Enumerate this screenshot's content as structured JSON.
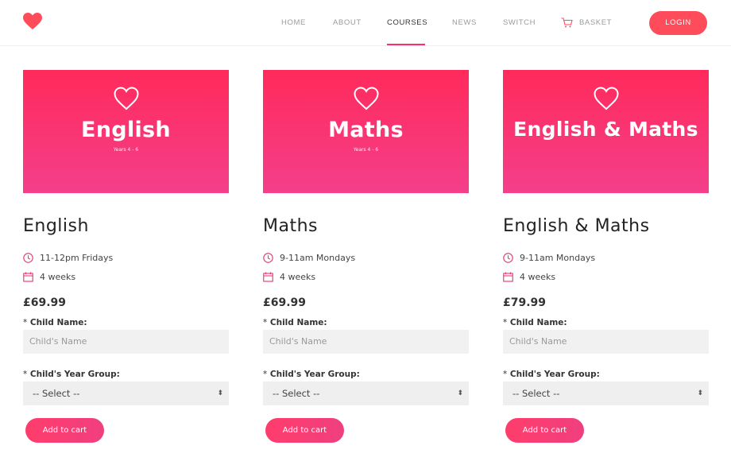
{
  "nav": {
    "items": [
      {
        "label": "HOME",
        "active": false
      },
      {
        "label": "ABOUT",
        "active": false
      },
      {
        "label": "COURSES",
        "active": true
      },
      {
        "label": "NEWS",
        "active": false
      },
      {
        "label": "SWITCH",
        "active": false
      }
    ],
    "basket_label": "BASKET",
    "login_label": "LOGIN",
    "brand_color": "#ff4c5b",
    "logo_icon": "heart-icon"
  },
  "cards": [
    {
      "banner_title": "English",
      "banner_subtitle": "Years 4 - 6",
      "title": "English",
      "time": "11-12pm Fridays",
      "duration": "4 weeks",
      "price": "£69.99",
      "child_name_label": "Child Name:",
      "child_name_placeholder": "Child's Name",
      "year_group_label": "Child's Year Group:",
      "year_group_selected": "-- Select --",
      "required_marker": "*",
      "cart_label": "Add to cart"
    },
    {
      "banner_title": "Maths",
      "banner_subtitle": "Years 4 - 6",
      "title": "Maths",
      "time": "9-11am Mondays",
      "duration": "4 weeks",
      "price": "£69.99",
      "child_name_label": "Child Name:",
      "child_name_placeholder": "Child's Name",
      "year_group_label": "Child's Year Group:",
      "year_group_selected": "-- Select --",
      "required_marker": "*",
      "cart_label": "Add to cart"
    },
    {
      "banner_title": "English & Maths",
      "banner_subtitle": "",
      "title": "English & Maths",
      "time": "9-11am Mondays",
      "duration": "4 weeks",
      "price": "£79.99",
      "child_name_label": "Child Name:",
      "child_name_placeholder": "Child's Name",
      "year_group_label": "Child's Year Group:",
      "year_group_selected": "-- Select --",
      "required_marker": "*",
      "cart_label": "Add to cart"
    }
  ],
  "colors": {
    "banner_top": "#ff2a5b",
    "banner_bottom": "#f43f8b",
    "icon_accent": "#e8336b"
  }
}
